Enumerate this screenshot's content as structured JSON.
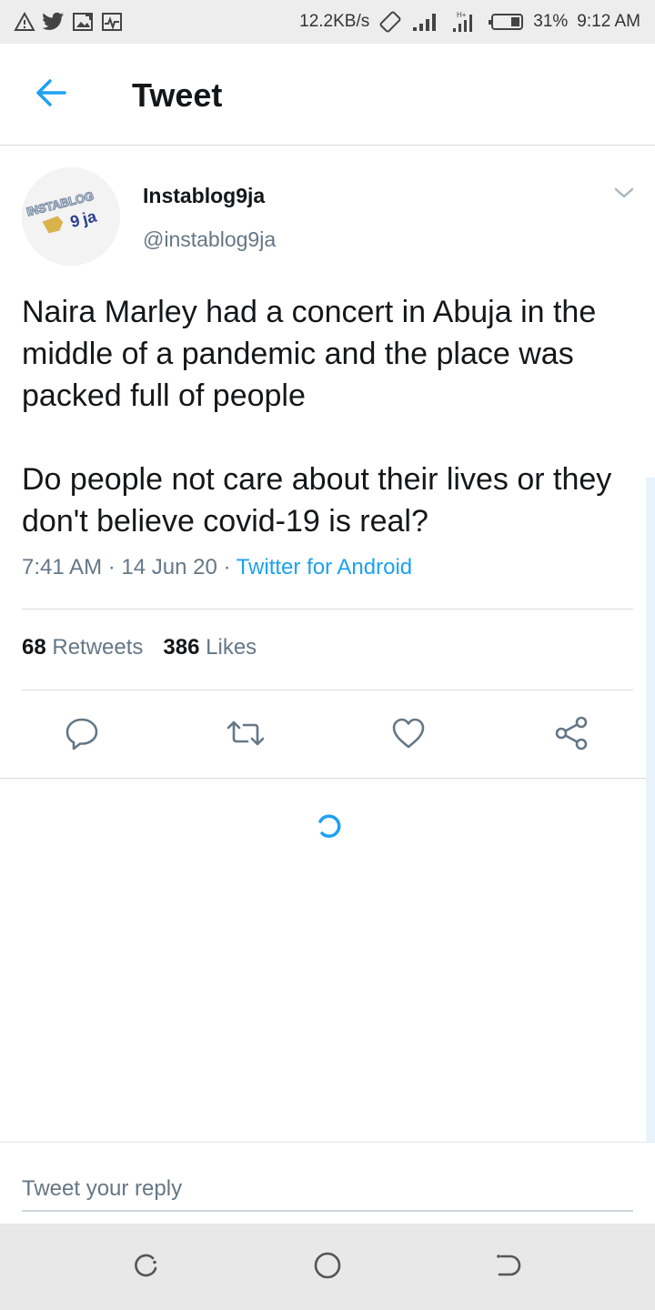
{
  "status_bar": {
    "left_icons": [
      "warning-icon",
      "twitter-bird-icon",
      "picture-icon",
      "activity-icon"
    ],
    "network_speed": "12.2KB/s",
    "battery_percent": "31%",
    "time": "9:12 AM"
  },
  "header": {
    "title": "Tweet",
    "back_icon": "arrow-left-icon"
  },
  "tweet": {
    "display_name": "Instablog9ja",
    "handle": "@instablog9ja",
    "body_paragraphs": [
      "Naira Marley had a concert in Abuja in the middle of a pandemic and the place was packed full of people",
      "Do people not care about their lives or they don't believe covid-19 is real?"
    ],
    "time": "7:41 AM",
    "date": "14 Jun 20",
    "separator": " · ",
    "source": "Twitter for Android",
    "retweets_count": "68",
    "retweets_label": "Retweets",
    "likes_count": "386",
    "likes_label": "Likes"
  },
  "actions": [
    "reply-icon",
    "retweet-icon",
    "like-icon",
    "share-icon"
  ],
  "reply": {
    "placeholder": "Tweet your reply"
  },
  "colors": {
    "accent": "#1da1f2",
    "secondary_text": "#657786",
    "primary_text": "#14171a"
  }
}
